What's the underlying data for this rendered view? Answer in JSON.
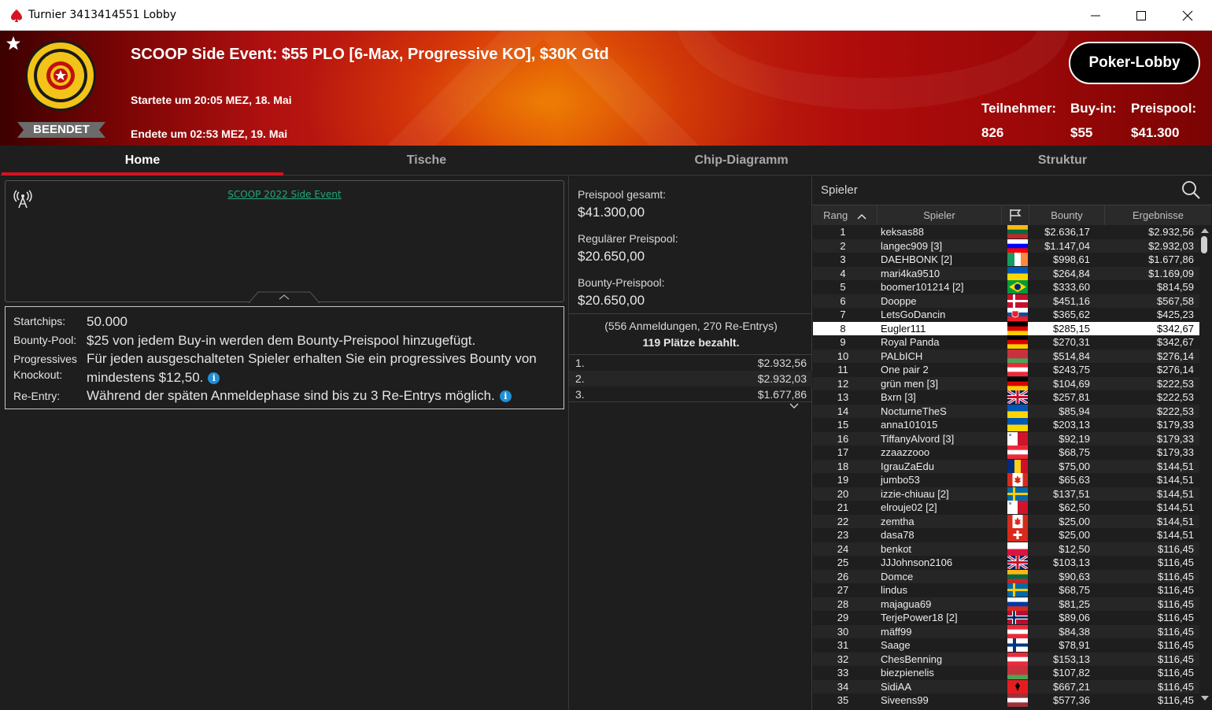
{
  "window": {
    "title": "Turnier 3413414551 Lobby"
  },
  "header": {
    "event_title": "SCOOP Side Event: $55 PLO [6-Max, Progressive KO], $30K Gtd",
    "started": "Startete um 20:05 MEZ, 18. Mai",
    "ended": "Endete um 02:53 MEZ, 19. Mai",
    "status": "BEENDET",
    "lobby_button": "Poker-Lobby",
    "stats": [
      {
        "label": "Teilnehmer:",
        "value": "826"
      },
      {
        "label": "Buy-in:",
        "value": "$55"
      },
      {
        "label": "Preispool:",
        "value": "$41.300"
      }
    ]
  },
  "tabs": [
    "Home",
    "Tische",
    "Chip-Diagramm",
    "Struktur"
  ],
  "feed": {
    "link": "SCOOP 2022 Side Event"
  },
  "info": {
    "rows": [
      {
        "key": "Startchips:",
        "value": "50.000"
      },
      {
        "key": "Bounty-Pool:",
        "value": "$25 von jedem Buy-in werden dem Bounty-Preispool hinzugefügt."
      },
      {
        "key": "Progressives",
        "key2": "Knockout:",
        "value": "Für jeden ausgeschalteten Spieler erhalten Sie ein progressives Bounty von",
        "value2": "mindestens $12,50."
      },
      {
        "key": "Re-Entry:",
        "value": "Während der späten Anmeldephase sind bis zu 3 Re-Entrys möglich."
      }
    ],
    "info_glyph": "i"
  },
  "pool": {
    "total_label": "Preispool gesamt:",
    "total_value": "$41.300,00",
    "regular_label": "Regulärer Preispool:",
    "regular_value": "$20.650,00",
    "bounty_label": "Bounty-Preispool:",
    "bounty_value": "$20.650,00",
    "registrations": "(556 Anmeldungen, 270 Re-Entrys)",
    "paid": "119 Plätze bezahlt.",
    "payouts": [
      {
        "place": "1.",
        "amount": "$2.932,56"
      },
      {
        "place": "2.",
        "amount": "$2.932,03"
      },
      {
        "place": "3.",
        "amount": "$1.677,86"
      }
    ]
  },
  "players": {
    "search_label": "Spieler",
    "columns": {
      "rank": "Rang",
      "player": "Spieler",
      "bounty": "Bounty",
      "result": "Ergebnisse"
    },
    "rows": [
      {
        "rank": "1",
        "name": "keksas88",
        "flag": "lt",
        "bounty": "$2.636,17",
        "result": "$2.932,56"
      },
      {
        "rank": "2",
        "name": "langec909 [3]",
        "flag": "si",
        "bounty": "$1.147,04",
        "result": "$2.932,03"
      },
      {
        "rank": "3",
        "name": "DAEHBONK [2]",
        "flag": "ie",
        "bounty": "$998,61",
        "result": "$1.677,86"
      },
      {
        "rank": "4",
        "name": "mari4ka9510",
        "flag": "ua",
        "bounty": "$264,84",
        "result": "$1.169,09"
      },
      {
        "rank": "5",
        "name": "boomer101214 [2]",
        "flag": "br",
        "bounty": "$333,60",
        "result": "$814,59"
      },
      {
        "rank": "6",
        "name": "Dooppe",
        "flag": "dk",
        "bounty": "$451,16",
        "result": "$567,58"
      },
      {
        "rank": "7",
        "name": "LetsGoDancin",
        "flag": "sk",
        "bounty": "$365,62",
        "result": "$425,23"
      },
      {
        "rank": "8",
        "name": "Eugler111",
        "flag": "de",
        "bounty": "$285,15",
        "result": "$342,67"
      },
      {
        "rank": "9",
        "name": "Royal Panda",
        "flag": "de",
        "bounty": "$270,31",
        "result": "$342,67"
      },
      {
        "rank": "10",
        "name": "PALbICH",
        "flag": "by",
        "bounty": "$514,84",
        "result": "$276,14"
      },
      {
        "rank": "11",
        "name": "One pair 2",
        "flag": "at",
        "bounty": "$243,75",
        "result": "$276,14"
      },
      {
        "rank": "12",
        "name": "grün men [3]",
        "flag": "de",
        "bounty": "$104,69",
        "result": "$222,53"
      },
      {
        "rank": "13",
        "name": "Bxrn [3]",
        "flag": "gb",
        "bounty": "$257,81",
        "result": "$222,53"
      },
      {
        "rank": "14",
        "name": "NocturneTheS",
        "flag": "ua",
        "bounty": "$85,94",
        "result": "$222,53"
      },
      {
        "rank": "15",
        "name": "anna101015",
        "flag": "ua",
        "bounty": "$203,13",
        "result": "$179,33"
      },
      {
        "rank": "16",
        "name": "TiffanyAlvord [3]",
        "flag": "mt",
        "bounty": "$92,19",
        "result": "$179,33"
      },
      {
        "rank": "17",
        "name": "zzaazzooo",
        "flag": "at",
        "bounty": "$68,75",
        "result": "$179,33"
      },
      {
        "rank": "18",
        "name": "IgrauZaEdu",
        "flag": "ro",
        "bounty": "$75,00",
        "result": "$144,51"
      },
      {
        "rank": "19",
        "name": "jumbo53",
        "flag": "ca",
        "bounty": "$65,63",
        "result": "$144,51"
      },
      {
        "rank": "20",
        "name": "izzie-chiuau [2]",
        "flag": "se",
        "bounty": "$137,51",
        "result": "$144,51"
      },
      {
        "rank": "21",
        "name": "elrouje02 [2]",
        "flag": "mt",
        "bounty": "$62,50",
        "result": "$144,51"
      },
      {
        "rank": "22",
        "name": "zemtha",
        "flag": "ca",
        "bounty": "$25,00",
        "result": "$144,51"
      },
      {
        "rank": "23",
        "name": "dasa78",
        "flag": "ch",
        "bounty": "$25,00",
        "result": "$144,51"
      },
      {
        "rank": "24",
        "name": "benkot",
        "flag": "pl",
        "bounty": "$12,50",
        "result": "$116,45"
      },
      {
        "rank": "25",
        "name": "JJJohnson2106",
        "flag": "gb",
        "bounty": "$103,13",
        "result": "$116,45"
      },
      {
        "rank": "26",
        "name": "Domce",
        "flag": "lt",
        "bounty": "$90,63",
        "result": "$116,45"
      },
      {
        "rank": "27",
        "name": "lindus",
        "flag": "se",
        "bounty": "$68,75",
        "result": "$116,45"
      },
      {
        "rank": "28",
        "name": "majagua69",
        "flag": "ru",
        "bounty": "$81,25",
        "result": "$116,45"
      },
      {
        "rank": "29",
        "name": "TerjePower18 [2]",
        "flag": "no",
        "bounty": "$89,06",
        "result": "$116,45"
      },
      {
        "rank": "30",
        "name": "mäff99",
        "flag": "at",
        "bounty": "$84,38",
        "result": "$116,45"
      },
      {
        "rank": "31",
        "name": "Saage",
        "flag": "fi",
        "bounty": "$78,91",
        "result": "$116,45"
      },
      {
        "rank": "32",
        "name": "ChesBenning",
        "flag": "at",
        "bounty": "$153,13",
        "result": "$116,45"
      },
      {
        "rank": "33",
        "name": "biezpienelis",
        "flag": "by",
        "bounty": "$107,82",
        "result": "$116,45"
      },
      {
        "rank": "34",
        "name": "SidiAA",
        "flag": "al",
        "bounty": "$667,21",
        "result": "$116,45"
      },
      {
        "rank": "35",
        "name": "Siveens99",
        "flag": "lv",
        "bounty": "$577,36",
        "result": "$116,45"
      }
    ],
    "selected_rank": "8"
  },
  "colors": {
    "accent_red": "#d71321",
    "link_green": "#1fa97a",
    "info_blue": "#1f8fd8",
    "badge_gold": "#f2c318"
  }
}
